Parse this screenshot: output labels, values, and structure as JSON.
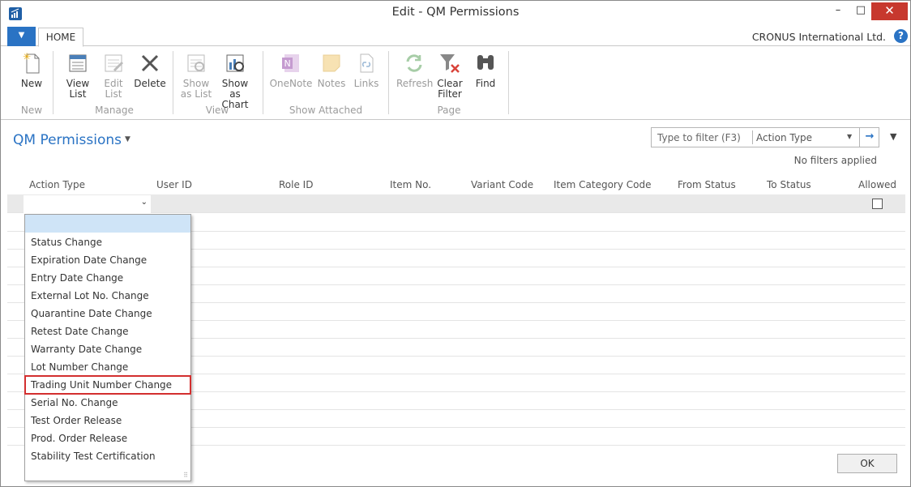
{
  "window": {
    "title": "Edit - QM Permissions",
    "minimize": "–",
    "maximize": "□",
    "close": "✕"
  },
  "ribbon_tabs": {
    "menu_glyph": "▼",
    "home": "HOME",
    "company": "CRONUS International Ltd.",
    "help": "?"
  },
  "ribbon": {
    "groups": {
      "new": "New",
      "manage": "Manage",
      "view": "View",
      "show_attached": "Show Attached",
      "page": "Page"
    },
    "buttons": {
      "new": "New",
      "view_list": "View\nList",
      "edit_list": "Edit\nList",
      "delete": "Delete",
      "show_as_list": "Show\nas List",
      "show_as_chart": "Show as\nChart",
      "onenote": "OneNote",
      "notes": "Notes",
      "links": "Links",
      "refresh": "Refresh",
      "clear_filter": "Clear\nFilter",
      "find": "Find"
    },
    "icons": {
      "new": "new-document-icon",
      "view_list": "view-list-icon",
      "edit_list": "edit-list-icon",
      "delete": "delete-x-icon",
      "show_as_list": "show-as-list-icon",
      "show_as_chart": "show-as-chart-icon",
      "onenote": "onenote-icon",
      "notes": "notes-icon",
      "links": "links-icon",
      "refresh": "refresh-icon",
      "clear_filter": "clear-filter-icon",
      "find": "binoculars-icon"
    }
  },
  "page": {
    "title": "QM Permissions",
    "title_caret": "▼",
    "filter_placeholder": "Type to filter (F3)",
    "filter_field": "Action Type",
    "filter_drop": "▼",
    "filter_go": "→",
    "collapse": "▼",
    "no_filters": "No filters applied"
  },
  "columns": [
    "Action Type",
    "User ID",
    "Role ID",
    "Item No.",
    "Variant Code",
    "Item Category Code",
    "From Status",
    "To Status",
    "Allowed"
  ],
  "new_row": {
    "action_type_value": "",
    "chevron": "⌄",
    "allowed": false
  },
  "dropdown_options": [
    "",
    "Status Change",
    "Expiration Date Change",
    "Entry Date Change",
    "External Lot No. Change",
    "Quarantine Date Change",
    "Retest Date Change",
    "Warranty Date Change",
    "Lot Number Change",
    "Trading Unit Number Change",
    "Serial No. Change",
    "Test Order Release",
    "Prod. Order Release",
    "Stability Test Certification"
  ],
  "highlighted_option": "Trading Unit Number Change",
  "ok_button": "OK",
  "colors": {
    "accent": "#2a73c4",
    "close": "#c7382e",
    "highlight_border": "#d32f2f",
    "dropdown_blank": "#cfe4f7"
  }
}
